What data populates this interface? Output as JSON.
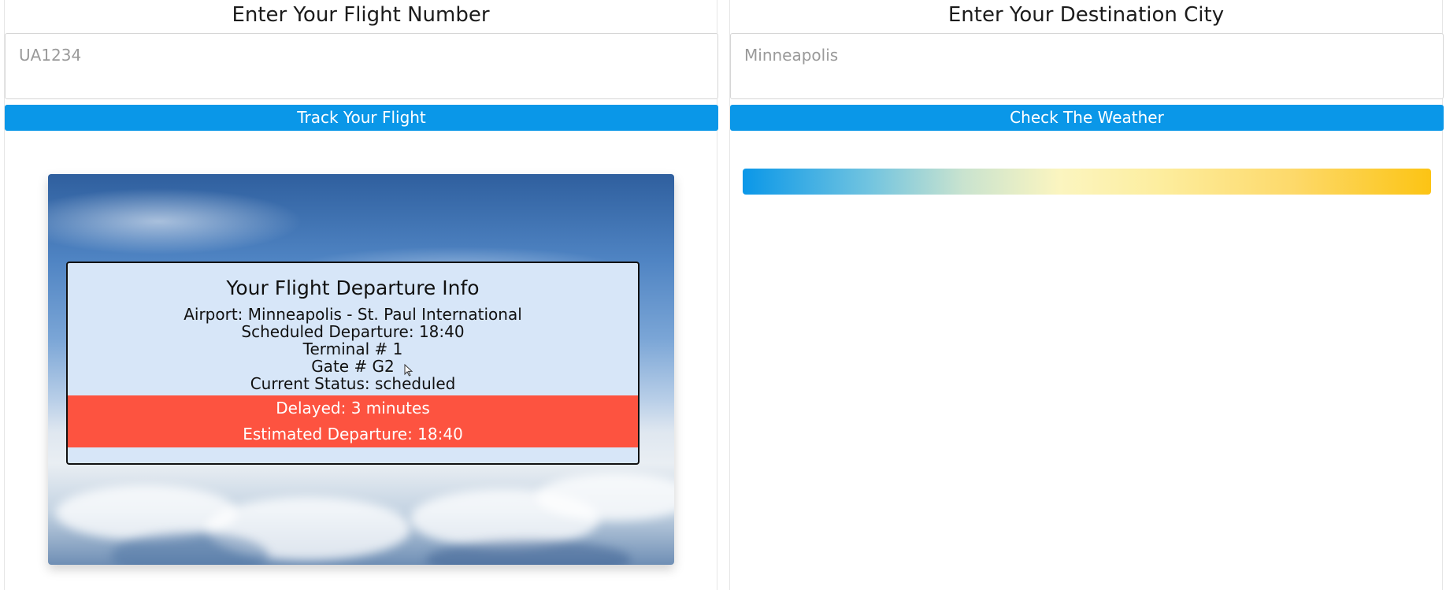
{
  "flight_panel": {
    "heading": "Enter Your Flight Number",
    "input_value": "",
    "input_placeholder": "UA1234",
    "button_label": "Track Your Flight",
    "card": {
      "title": "Your Flight Departure Info",
      "airport": "Airport: Minneapolis - St. Paul International",
      "scheduled_departure": "Scheduled Departure: 18:40",
      "terminal": "Terminal # 1",
      "gate": "Gate # G2",
      "status": "Current Status: scheduled",
      "delay": "Delayed: 3 minutes",
      "estimated_departure": "Estimated Departure: 18:40"
    }
  },
  "weather_panel": {
    "heading": "Enter Your Destination City",
    "input_value": "",
    "input_placeholder": "Minneapolis",
    "button_label": "Check The Weather",
    "gradient_colors": [
      "#0a97e8",
      "#fbf5c0",
      "#fcc414"
    ]
  },
  "icons": {
    "cursor": "mouse-pointer-icon"
  },
  "colors": {
    "button": "#0a97e8",
    "card_background": "#d7e6f8",
    "delay_band": "#fd5340"
  }
}
